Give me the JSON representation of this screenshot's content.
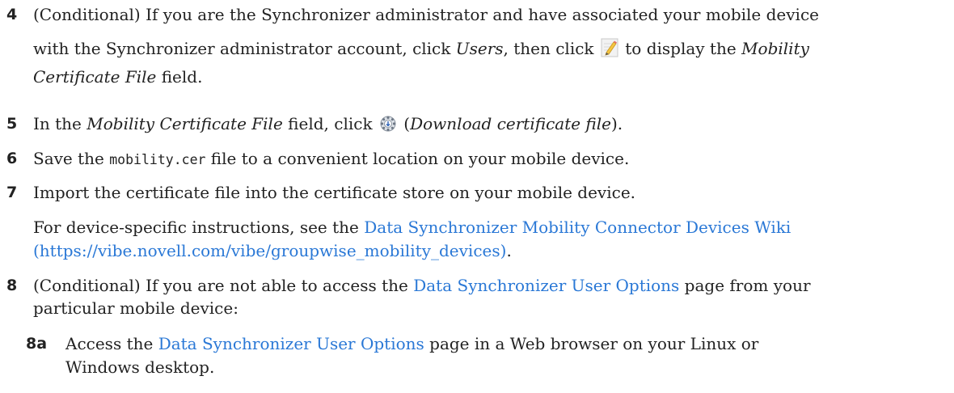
{
  "steps": {
    "s4": {
      "number": "4",
      "l1": "(Conditional) If you are the Synchronizer administrator and have associated your mobile device",
      "l2a": "with the Synchronizer administrator account, click ",
      "l2b": "Users",
      "l2c": ", then click ",
      "l2d": " to display the ",
      "l2e": "Mobility",
      "l3a": "Certificate File",
      "l3b": " field.",
      "edit_icon": "pencil-edit-icon"
    },
    "s5": {
      "number": "5",
      "a": "In the ",
      "b": "Mobility Certificate File",
      "c": " field, click ",
      "d": " (",
      "e": "Download certificate file",
      "f": ").",
      "download_icon": "gear-download-icon"
    },
    "s6": {
      "number": "6",
      "a": "Save the ",
      "code": "mobility.cer",
      "b": " file to a convenient location on your mobile device."
    },
    "s7": {
      "number": "7",
      "text": "Import the certificate file into the certificate store on your mobile device.",
      "p2a": "For device-specific instructions, see the ",
      "link1": "Data Synchronizer Mobility Connector Devices Wiki",
      "link2": "(https://vibe.novell.com/vibe/groupwise_mobility_devices)",
      "p2b": "."
    },
    "s8": {
      "number": "8",
      "l1a": "(Conditional) If you are not able to access the ",
      "l1link": "Data Synchronizer User Options",
      "l1b": " page from your",
      "l2": "particular mobile device:"
    },
    "s8a": {
      "number": "8a",
      "a": "Access the ",
      "link": "Data Synchronizer User Options",
      "b": " page in a Web browser on your Linux or",
      "l2": "Windows desktop."
    }
  },
  "colors": {
    "link": "#2a78d6",
    "text": "#222222"
  }
}
